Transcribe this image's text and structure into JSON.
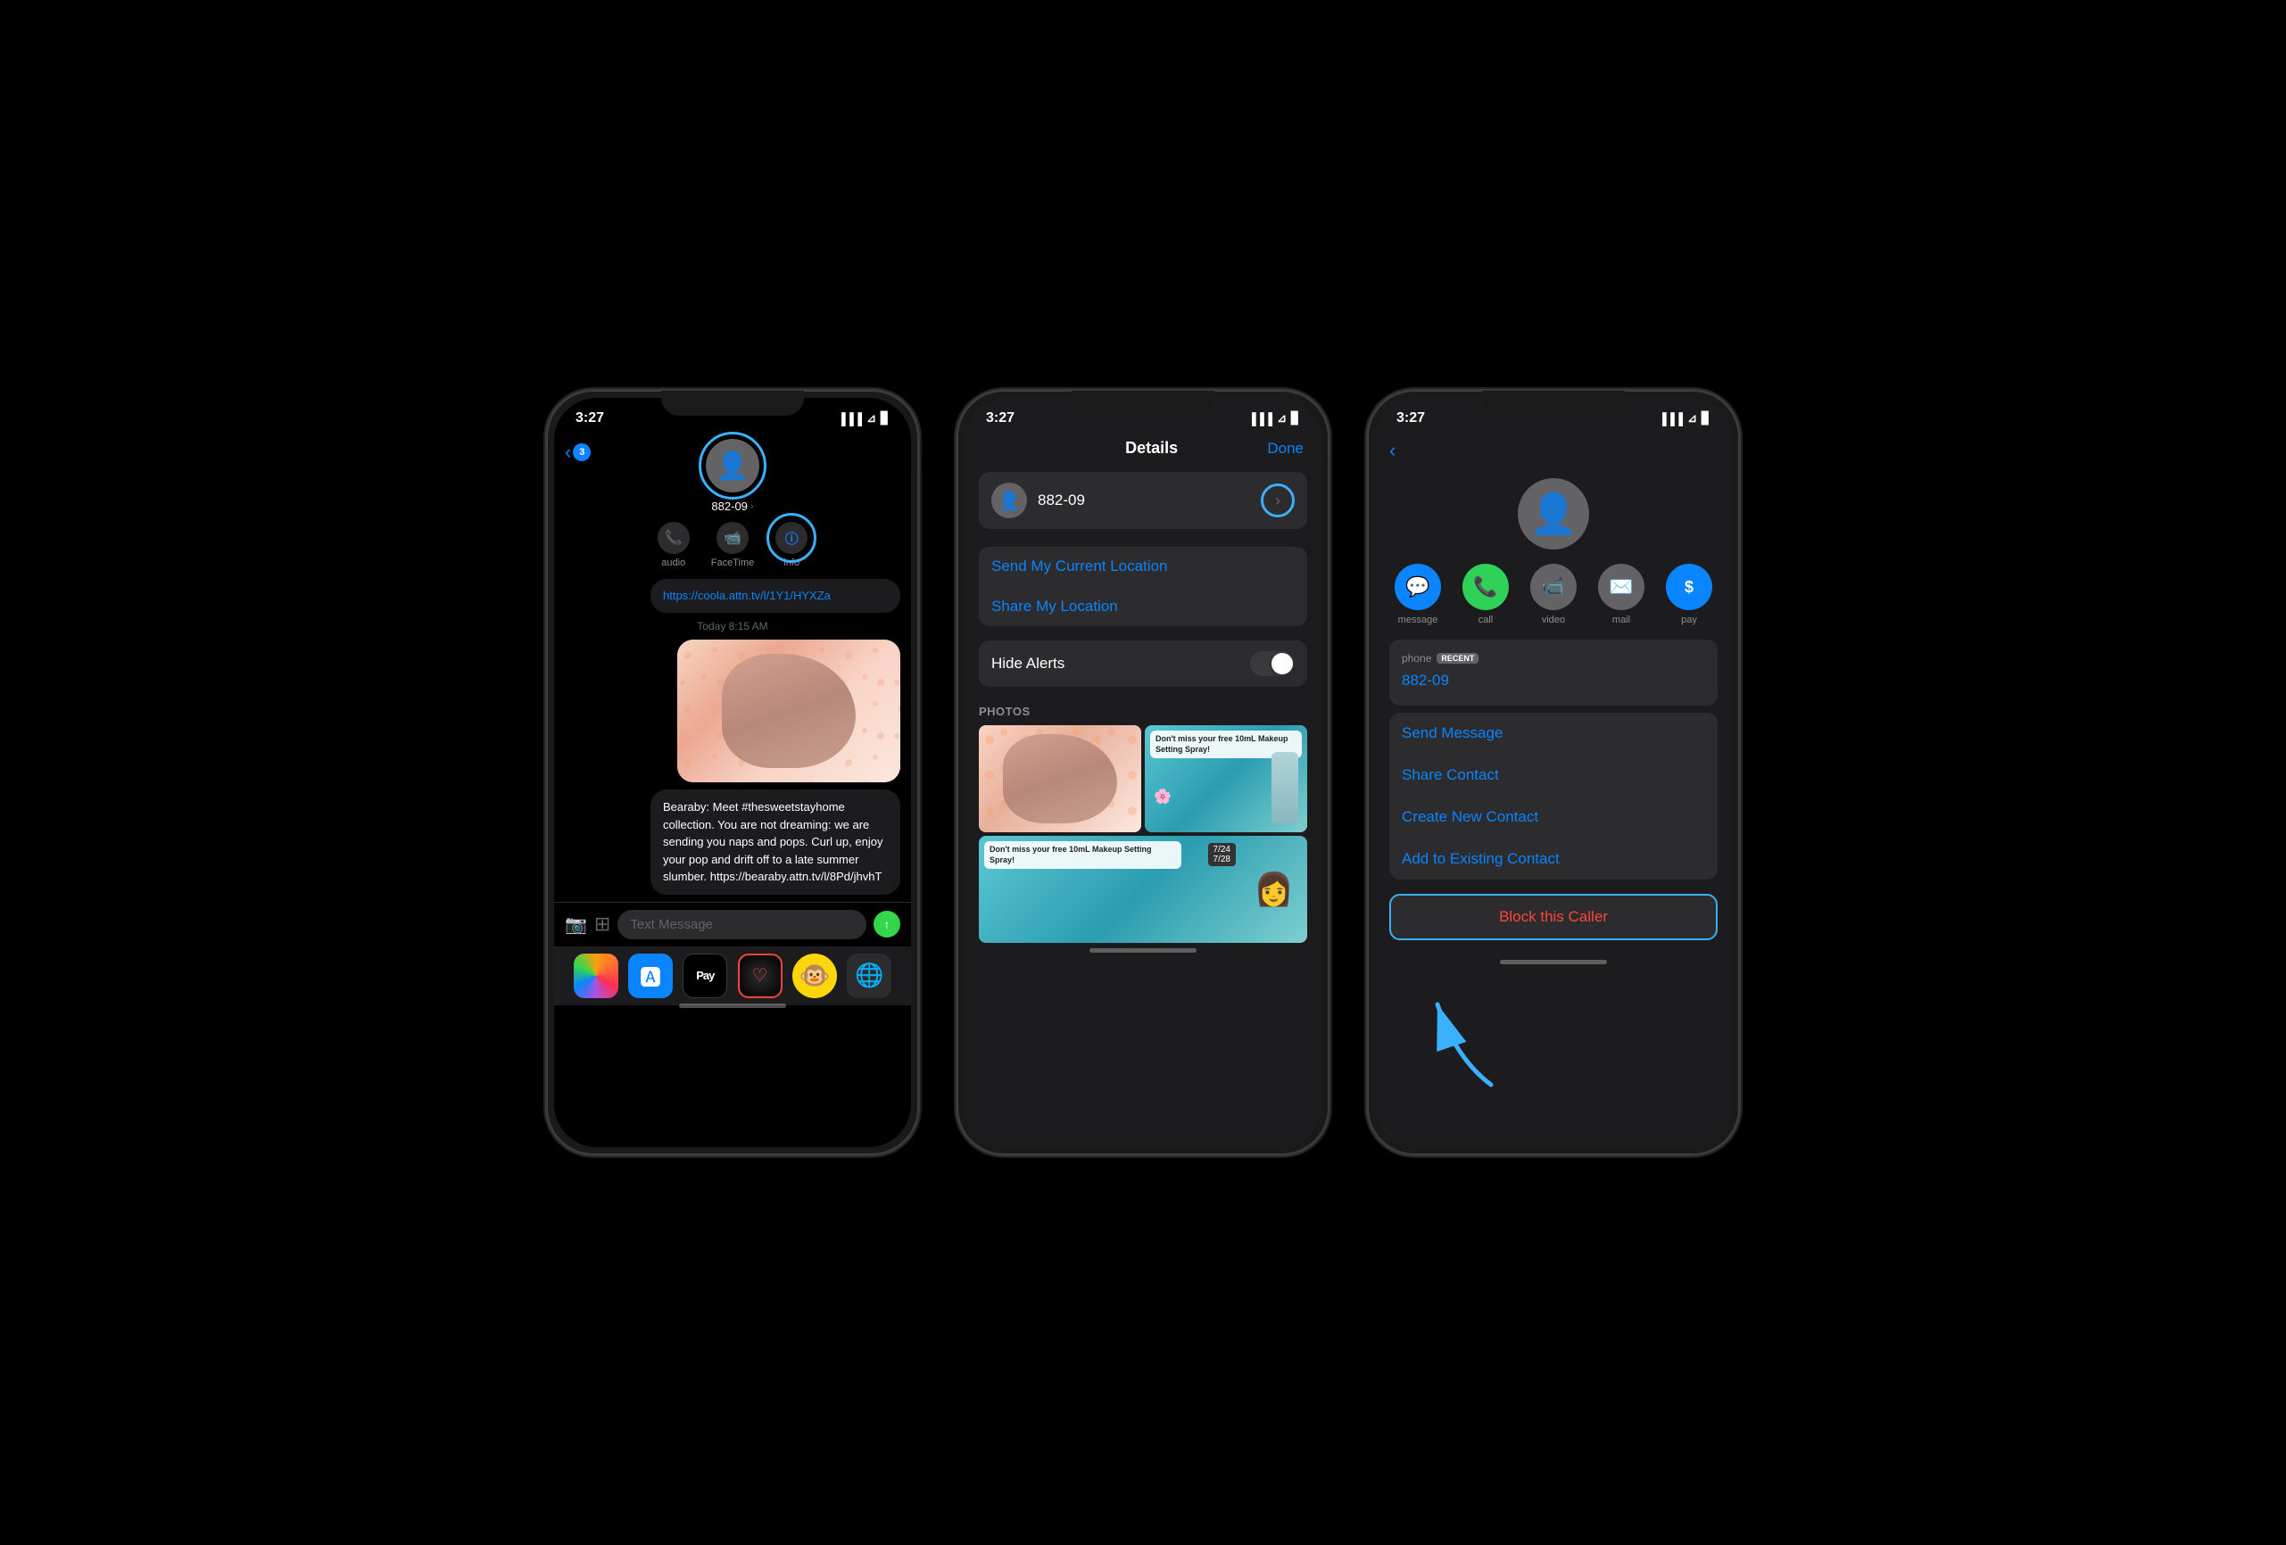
{
  "background_color": "#000000",
  "phones": [
    {
      "id": "phone1",
      "screen": "messages",
      "status_bar": {
        "time": "3:27",
        "signal": "●●●●",
        "wifi": "wifi",
        "battery": "battery"
      },
      "header": {
        "back_count": "3",
        "contact_name": "882-09",
        "chevron_down": "›",
        "actions": [
          "audio",
          "FaceTime",
          "info"
        ]
      },
      "messages": [
        {
          "type": "link",
          "text": "https://coola.attn.tv/l/1Y1/HYXZa"
        },
        {
          "type": "timestamp",
          "text": "Today 8:15 AM"
        },
        {
          "type": "image",
          "description": "Bearaby product photo"
        },
        {
          "type": "text",
          "text": "Bearaby: Meet #thesweetstayhome collection. You are not dreaming: we are sending you naps and pops. Curl up, enjoy your pop and drift off to a late summer slumber. https://bearaby.attn.tv/l/8Pd/jhvhT"
        }
      ],
      "input_placeholder": "Text Message",
      "dock_items": [
        "Photos",
        "App Store",
        "Apple Pay",
        "Fitness",
        "Memoji"
      ]
    },
    {
      "id": "phone2",
      "screen": "details",
      "status_bar": {
        "time": "3:27"
      },
      "header": {
        "title": "Details",
        "done_btn": "Done"
      },
      "contact": {
        "name": "882-09"
      },
      "location_buttons": [
        "Send My Current Location",
        "Share My Location"
      ],
      "hide_alerts_label": "Hide Alerts",
      "toggle_state": "off",
      "photos_section_label": "PHOTOS",
      "photos": [
        {
          "description": "Bearaby product pink",
          "position": "top-left"
        },
        {
          "description": "Makeup setting spray teal",
          "text_overlay": "Don't miss your free 10mL Makeup Setting Spray!",
          "position": "top-right"
        },
        {
          "description": "Makeup setting spray bottom",
          "text_overlay": "Don't miss your free 10mL Makeup Setting Spray!",
          "position": "bottom-full"
        }
      ]
    },
    {
      "id": "phone3",
      "screen": "contact",
      "status_bar": {
        "time": "3:27"
      },
      "contact": {
        "name": "882-09",
        "phone_label": "phone",
        "phone_badge": "RECENT",
        "phone_number": "882-09"
      },
      "actions": [
        {
          "id": "message",
          "label": "message",
          "icon": "💬"
        },
        {
          "id": "call",
          "label": "call",
          "icon": "📞"
        },
        {
          "id": "video",
          "label": "video",
          "icon": "📹"
        },
        {
          "id": "mail",
          "label": "mail",
          "icon": "✉️"
        },
        {
          "id": "pay",
          "label": "pay",
          "icon": "$"
        }
      ],
      "contact_options": [
        "Send Message",
        "Share Contact",
        "Create New Contact",
        "Add to Existing Contact"
      ],
      "block_caller_label": "Block this Caller"
    }
  ],
  "annotations": {
    "arrow_color": "#3ab0ff",
    "highlight_color": "#3ab0ff"
  }
}
